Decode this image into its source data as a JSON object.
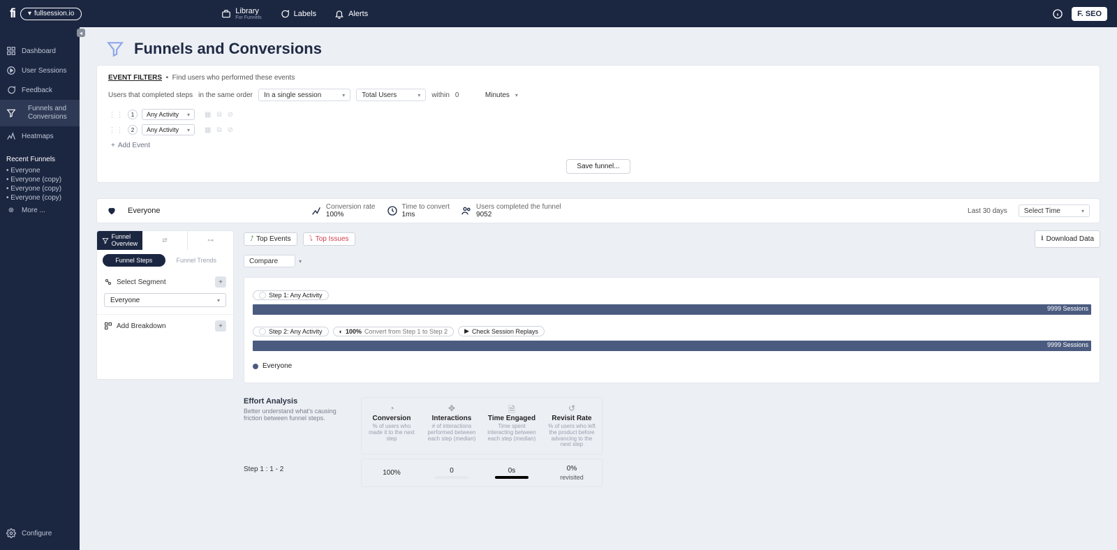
{
  "topbar": {
    "org": "fullsession.io",
    "nav": {
      "library": "Library",
      "library_sub": "For Funnels",
      "labels": "Labels",
      "alerts": "Alerts"
    },
    "user": "F. SEO"
  },
  "sidebar": {
    "items": {
      "dashboard": "Dashboard",
      "sessions": "User Sessions",
      "feedback": "Feedback",
      "funnels_l1": "Funnels and",
      "funnels_l2": "Conversions",
      "heatmaps": "Heatmaps"
    },
    "recent_title": "Recent Funnels",
    "recent": [
      "Everyone",
      "Everyone (copy)",
      "Everyone (copy)",
      "Everyone (copy)"
    ],
    "more": "More ...",
    "configure": "Configure"
  },
  "page": {
    "title": "Funnels and Conversions"
  },
  "filters": {
    "title": "EVENT FILTERS",
    "subtitle": "Find users who performed these events",
    "line": {
      "a": "Users that completed steps",
      "b": "in the same order",
      "session": "In a single session",
      "total": "Total Users",
      "within": "within",
      "num": "0",
      "unit": "Minutes"
    },
    "steps": [
      {
        "n": "1",
        "label": "Any Activity"
      },
      {
        "n": "2",
        "label": "Any Activity"
      }
    ],
    "add": "Add Event",
    "save": "Save funnel..."
  },
  "summary": {
    "segment": "Everyone",
    "conv_t": "Conversion rate",
    "conv_v": "100%",
    "time_t": "Time to convert",
    "time_v": "1ms",
    "users_t": "Users completed the funnel",
    "users_v": "9052",
    "range": "Last 30 days",
    "select_time": "Select Time"
  },
  "panel": {
    "tab1a": "Funnel",
    "tab1b": "Overview",
    "pill_a": "Funnel Steps",
    "pill_b": "Funnel Trends",
    "select_segment": "Select Segment",
    "seg_value": "Everyone",
    "add_breakdown": "Add Breakdown"
  },
  "rcol": {
    "top_events": "Top Events",
    "top_issues": "Top Issues",
    "download": "Download Data",
    "compare": "Compare"
  },
  "funnel": {
    "s1": {
      "label": "Step 1: Any Activity",
      "bar": "9999 Sessions"
    },
    "s2": {
      "label": "Step 2: Any Activity",
      "conv": "100% ",
      "conv_txt": "Convert from Step 1 to Step 2",
      "replay": "Check Session Replays",
      "bar": "9999 Sessions"
    },
    "legend": "Everyone"
  },
  "effort": {
    "title": "Effort Analysis",
    "desc": "Better understand what's causing friction between funnel steps.",
    "metrics": [
      {
        "t": "Conversion",
        "d": "% of users who made it to the next step"
      },
      {
        "t": "Interactions",
        "d": "# of interactions performed between each step (median)"
      },
      {
        "t": "Time Engaged",
        "d": "Time spent interacting between each step (median)"
      },
      {
        "t": "Revisit Rate",
        "d": "% of users who left the product before advancing to the next step"
      }
    ],
    "step_lbl": "Step 1 : 1 - 2",
    "vals": {
      "conv": "100%",
      "inter": "0",
      "time": "0s",
      "revisit_a": "0%",
      "revisit_b": "revisited"
    }
  },
  "chart_data": {
    "type": "bar",
    "orientation": "horizontal",
    "title": "Funnel: Everyone",
    "categories": [
      "Step 1: Any Activity",
      "Step 2: Any Activity"
    ],
    "values": [
      9999,
      9999
    ],
    "unit": "Sessions",
    "conversion_rate_pct": [
      null,
      100
    ],
    "ylim": [
      0,
      9999
    ]
  }
}
